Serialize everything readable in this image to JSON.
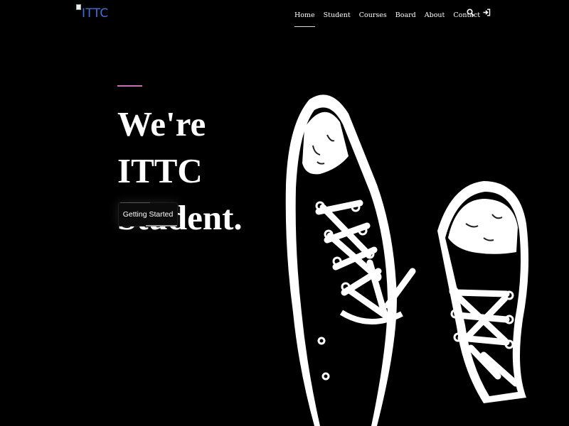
{
  "header": {
    "logo_alt": "ITTC",
    "nav": [
      {
        "label": "Home",
        "active": true
      },
      {
        "label": "Student"
      },
      {
        "label": "Courses"
      },
      {
        "label": "Board"
      },
      {
        "label": "About"
      },
      {
        "label": "Contact"
      }
    ],
    "icons": [
      "search-icon",
      "sign-in-icon"
    ]
  },
  "hero": {
    "title_line1": "We're ITTC",
    "title_line2": "Student.",
    "cta_label": "Getting Started",
    "image": "sneakers-illustration"
  },
  "colors": {
    "background": "#000000",
    "accent": "#c86fb5",
    "logo": "#3b73d9"
  }
}
